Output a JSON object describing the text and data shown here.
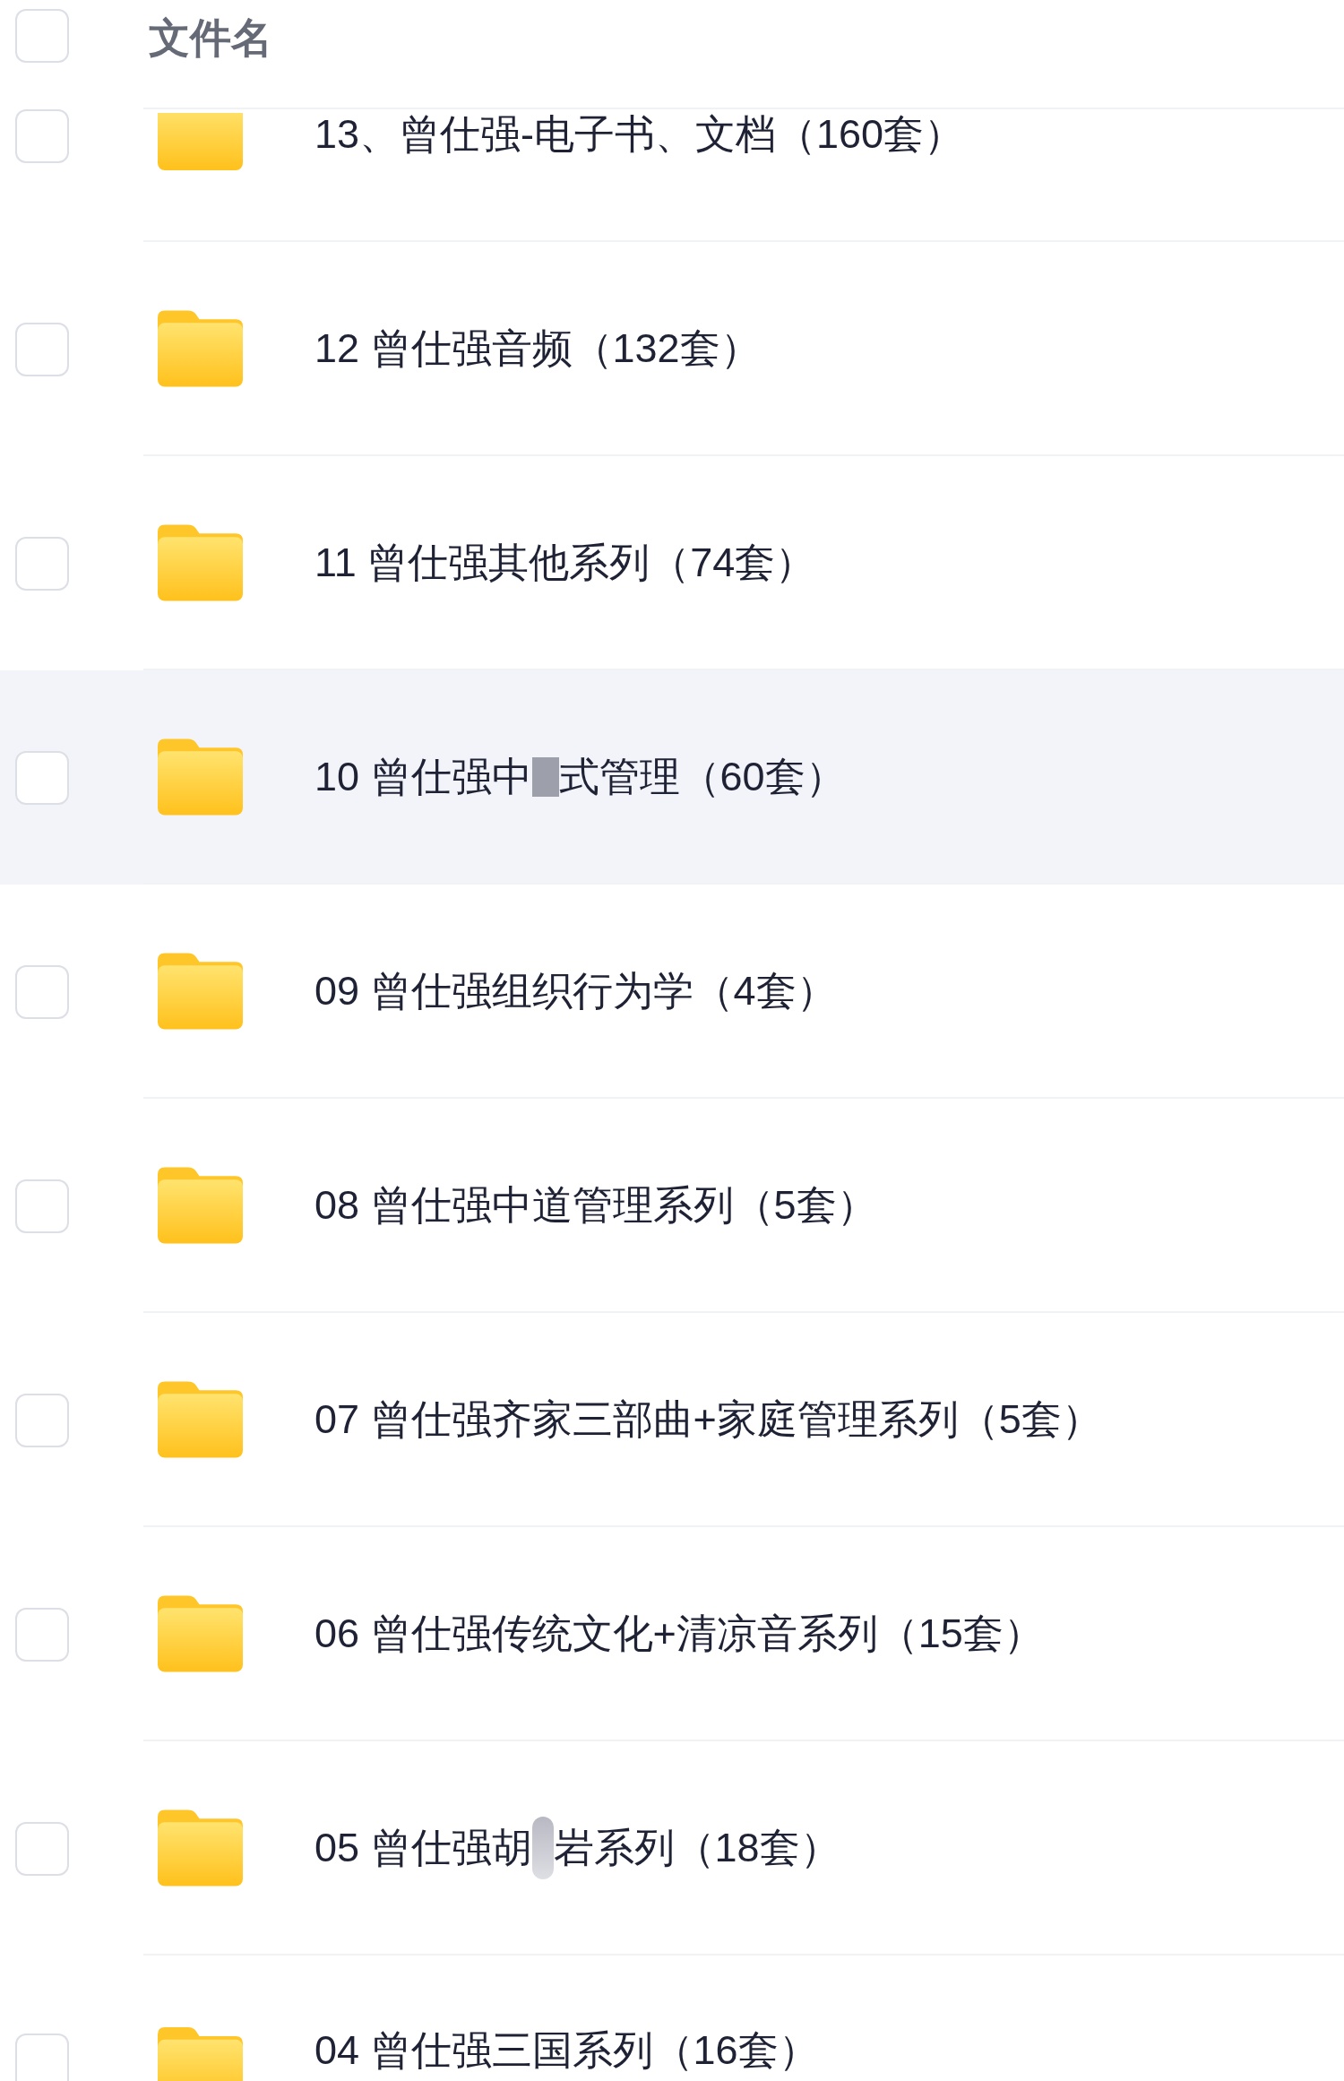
{
  "header": {
    "checked": false,
    "label": "文件名"
  },
  "rows": [
    {
      "checked": false,
      "hovered": false,
      "segments": [
        {
          "kind": "text",
          "text": "13、曾仕强-电子书、文档（160套）"
        }
      ]
    },
    {
      "checked": false,
      "hovered": false,
      "segments": [
        {
          "kind": "text",
          "text": "12 曾仕强音频（132套）"
        }
      ]
    },
    {
      "checked": false,
      "hovered": false,
      "segments": [
        {
          "kind": "text",
          "text": "11 曾仕强其他系列（74套）"
        }
      ]
    },
    {
      "checked": false,
      "hovered": true,
      "segments": [
        {
          "kind": "text",
          "text": "10 曾仕强中"
        },
        {
          "kind": "block"
        },
        {
          "kind": "text",
          "text": "式管理（60套）"
        }
      ]
    },
    {
      "checked": false,
      "hovered": false,
      "segments": [
        {
          "kind": "text",
          "text": "09 曾仕强组织行为学（4套）"
        }
      ]
    },
    {
      "checked": false,
      "hovered": false,
      "segments": [
        {
          "kind": "text",
          "text": "08 曾仕强中道管理系列（5套）"
        }
      ]
    },
    {
      "checked": false,
      "hovered": false,
      "segments": [
        {
          "kind": "text",
          "text": "07 曾仕强齐家三部曲+家庭管理系列（5套）"
        }
      ]
    },
    {
      "checked": false,
      "hovered": false,
      "segments": [
        {
          "kind": "text",
          "text": "06 曾仕强传统文化+清凉音系列（15套）"
        }
      ]
    },
    {
      "checked": false,
      "hovered": false,
      "segments": [
        {
          "kind": "text",
          "text": "05 曾仕强胡"
        },
        {
          "kind": "smudge"
        },
        {
          "kind": "text",
          "text": "岩系列（18套）"
        }
      ]
    },
    {
      "checked": false,
      "hovered": false,
      "segments": [
        {
          "kind": "text",
          "text": "04 曾仕强三国系列（16套）"
        }
      ]
    }
  ]
}
